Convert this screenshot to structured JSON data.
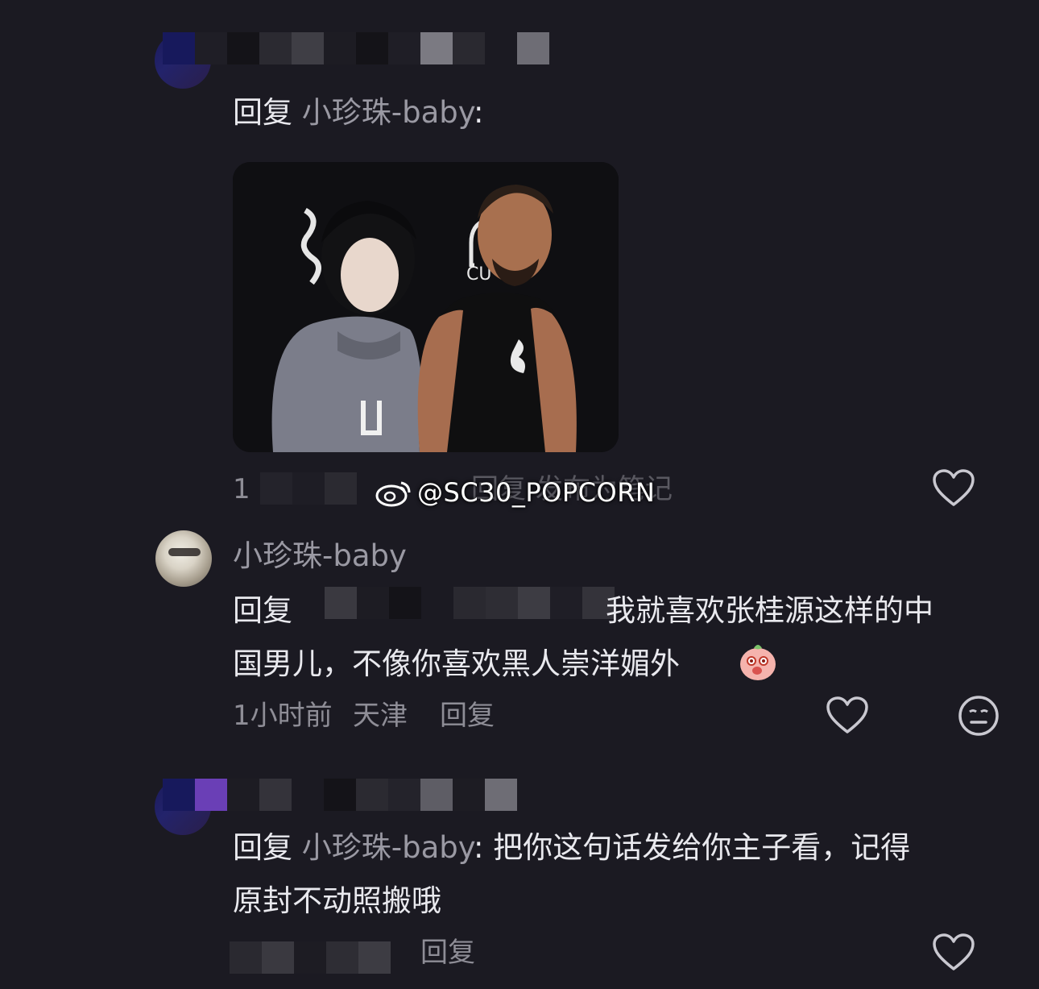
{
  "comments": [
    {
      "reply_prefix": "回复",
      "reply_to": "小珍珠-baby",
      "colon": ":",
      "footer_fragment": "1",
      "footer_reply": "回复",
      "footer_publish": "发布为笔记"
    },
    {
      "username": "小珍珠-baby",
      "reply_prefix": "回复",
      "body_line1": "我就喜欢张桂源这样的中",
      "body_line2": "国男儿，不像你喜欢黑人崇洋媚外",
      "time": "1小时前",
      "location": "天津",
      "footer_reply": "回复"
    },
    {
      "reply_prefix": "回复",
      "reply_to": "小珍珠-baby",
      "body_line1": ": 把你这句话发给你主子看，记得",
      "body_line2": "原封不动照搬哦",
      "footer_reply": "回复"
    }
  ],
  "watermark": "@SC30_POPCORN",
  "icons": {
    "like": "heart-outline-icon",
    "dislike": "neutral-face-icon",
    "weibo": "weibo-logo-icon",
    "emoji": "peach-emoji-icon"
  },
  "colors": {
    "background": "#1b1a22",
    "text_primary": "#e9e9ee",
    "text_secondary": "#9a99a3"
  }
}
